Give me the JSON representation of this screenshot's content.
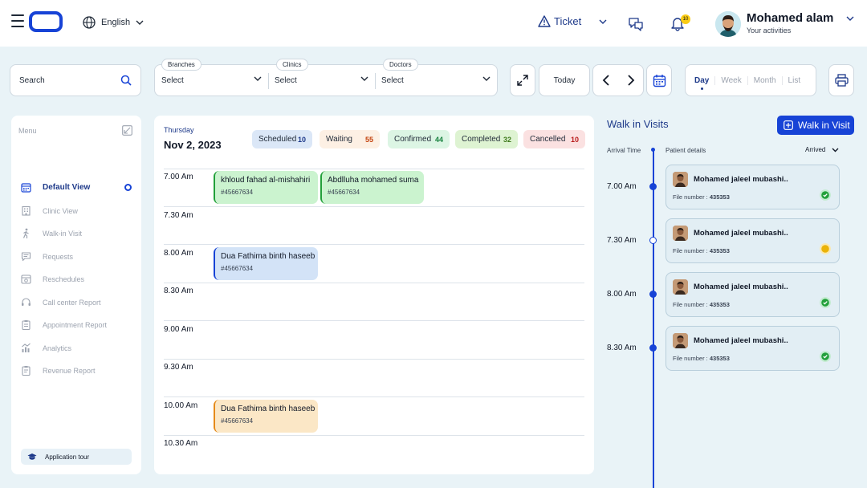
{
  "header": {
    "language": "English",
    "ticket_label": "Ticket",
    "notification_count": "10",
    "user_name": "Mohamed alam",
    "user_subtitle": "Your activities"
  },
  "toolbar": {
    "search_placeholder": "Search",
    "filters": [
      {
        "label": "Branches",
        "value": "Select"
      },
      {
        "label": "Clinics",
        "value": "Select"
      },
      {
        "label": "Doctors",
        "value": "Select"
      }
    ],
    "today_label": "Today",
    "views": [
      "Day",
      "Week",
      "Month",
      "List"
    ],
    "active_view": "Day"
  },
  "sidebar": {
    "menu_label": "Menu",
    "items": [
      {
        "label": "Default View",
        "icon": "calendar-icon",
        "active": true
      },
      {
        "label": "Clinic View",
        "icon": "building-icon"
      },
      {
        "label": "Walk-in Visit",
        "icon": "walking-icon"
      },
      {
        "label": "Requests",
        "icon": "chat-icon"
      },
      {
        "label": "Reschedules",
        "icon": "reschedule-icon"
      },
      {
        "label": "Call center Report",
        "icon": "headset-icon"
      },
      {
        "label": "Appointment Report",
        "icon": "clipboard-icon"
      },
      {
        "label": "Analytics",
        "icon": "analytics-icon"
      },
      {
        "label": "Revenue Report",
        "icon": "report-icon"
      }
    ],
    "tour_label": "Application tour"
  },
  "calendar": {
    "weekday": "Thursday",
    "date": "Nov 2, 2023",
    "statuses": [
      {
        "label": "Scheduled",
        "count": "10",
        "bg": "#dbe7f7",
        "fg": "#1e3a8a"
      },
      {
        "label": "Waiting",
        "count": "55",
        "bg": "#fdf0e4",
        "fg": "#c2410c"
      },
      {
        "label": "Confirmed",
        "count": "44",
        "bg": "#dcf5e4",
        "fg": "#15803d"
      },
      {
        "label": "Completed",
        "count": "32",
        "bg": "#def3d2",
        "fg": "#3f7a1c"
      },
      {
        "label": "Cancelled",
        "count": "10",
        "bg": "#fbe1e1",
        "fg": "#b91c1c"
      }
    ],
    "slots": [
      "7.00 Am",
      "7.30 Am",
      "8.00 Am",
      "8.30 Am",
      "9.00 Am",
      "9.30 Am",
      "10.00 Am",
      "10.30 Am"
    ],
    "appointments": [
      {
        "name": "khloud fahad al-mishahiri",
        "id": "#45667634",
        "color": "green"
      },
      {
        "name": "Abdlluha mohamed suma",
        "id": "#45667634",
        "color": "green"
      },
      {
        "name": "Dua Fathima binth haseeb",
        "id": "#45667634",
        "color": "blue"
      },
      {
        "name": "Dua Fathima binth haseeb",
        "id": "#45667634",
        "color": "orange"
      }
    ]
  },
  "walkin": {
    "title": "Walk in Visits",
    "button_label": "Walk in Visit",
    "col_arrival": "Arrival Time",
    "col_patient": "Patient details",
    "sort_label": "Arrived",
    "visits": [
      {
        "time": "7.00 Am",
        "name": "Mohamed jaleel mubashi..",
        "file_label": "File number : ",
        "file_no": "435353",
        "status": "done"
      },
      {
        "time": "7.30 Am",
        "name": "Mohamed jaleel mubashi..",
        "file_label": "File number : ",
        "file_no": "435353",
        "status": "pending"
      },
      {
        "time": "8.00 Am",
        "name": "Mohamed jaleel mubashi..",
        "file_label": "File number : ",
        "file_no": "435353",
        "status": "done"
      },
      {
        "time": "8.30 Am",
        "name": "Mohamed jaleel mubashi..",
        "file_label": "File number : ",
        "file_no": "435353",
        "status": "done"
      }
    ]
  }
}
